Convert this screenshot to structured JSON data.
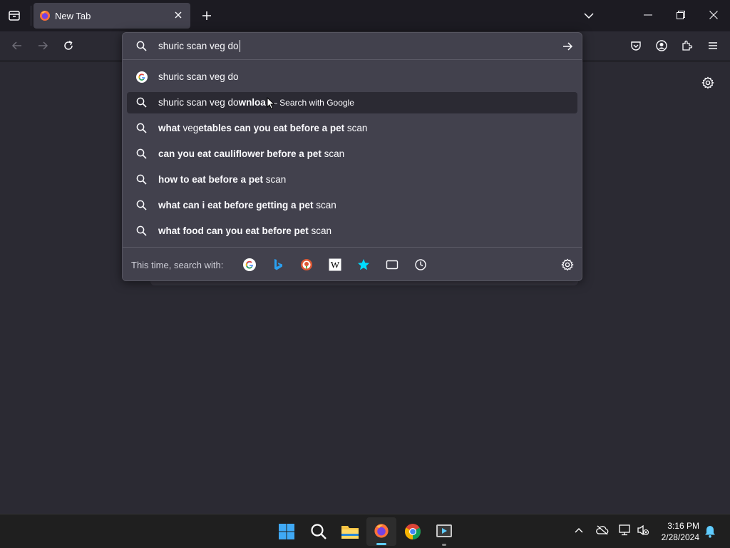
{
  "tab": {
    "title": "New Tab"
  },
  "urlbar": {
    "value": "shuric scan veg do"
  },
  "suggestions": [
    {
      "pre": "shuric scan veg do",
      "bold": "",
      "post": "",
      "suffix": "",
      "icon": "google-icon"
    },
    {
      "pre": "shuric scan veg do",
      "bold": "wnloa",
      "post": "",
      "suffix": "— Search with Google",
      "icon": "search-icon"
    },
    {
      "pre": "",
      "bold": "what ",
      "post": "veg",
      "bold2": "etables can you eat before a pet",
      "post2": " scan",
      "icon": "search-icon"
    },
    {
      "pre": "",
      "bold": "can you eat cauliflower before a pet",
      "post": " scan",
      "icon": "search-icon"
    },
    {
      "pre": "",
      "bold": "how to eat before a pet",
      "post": " scan",
      "icon": "search-icon"
    },
    {
      "pre": "",
      "bold": "what can i eat before getting a pet",
      "post": " scan",
      "icon": "search-icon"
    },
    {
      "pre": "",
      "bold": "what food can you eat before pet",
      "post": " scan",
      "icon": "search-icon"
    }
  ],
  "oneoff": {
    "label": "This time, search with:",
    "engines": [
      "google",
      "bing",
      "duckduckgo",
      "wikipedia",
      "bookmarks",
      "tabs",
      "history"
    ]
  },
  "taskbar": {
    "time": "3:16 PM",
    "date": "2/28/2024"
  },
  "colors": {
    "accent": "#00ddff",
    "panel": "#42414d",
    "background": "#2b2a33"
  }
}
